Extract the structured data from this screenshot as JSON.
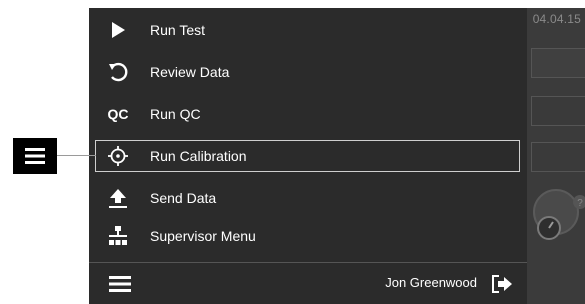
{
  "background": {
    "date_fragment": "04.04.15"
  },
  "menu": {
    "items": [
      {
        "label": "Run Test",
        "icon": "play-icon"
      },
      {
        "label": "Review Data",
        "icon": "undo-icon"
      },
      {
        "label": "Run QC",
        "icon": "qc-icon",
        "icon_text": "QC"
      },
      {
        "label": "Run Calibration",
        "icon": "crosshair-icon",
        "highlighted": true
      },
      {
        "label": "Send Data",
        "icon": "upload-icon"
      },
      {
        "label": "Supervisor Menu",
        "icon": "hierarchy-icon"
      }
    ]
  },
  "footer": {
    "user_name": "Jon Greenwood",
    "menu_icon": "hamburger-icon",
    "logout_icon": "logout-icon"
  },
  "callout": {
    "icon": "hamburger-icon"
  },
  "colors": {
    "drawer_bg": "#2b2b2b",
    "highlight_border": "#cfcfcf",
    "callout_bg": "#000000"
  }
}
